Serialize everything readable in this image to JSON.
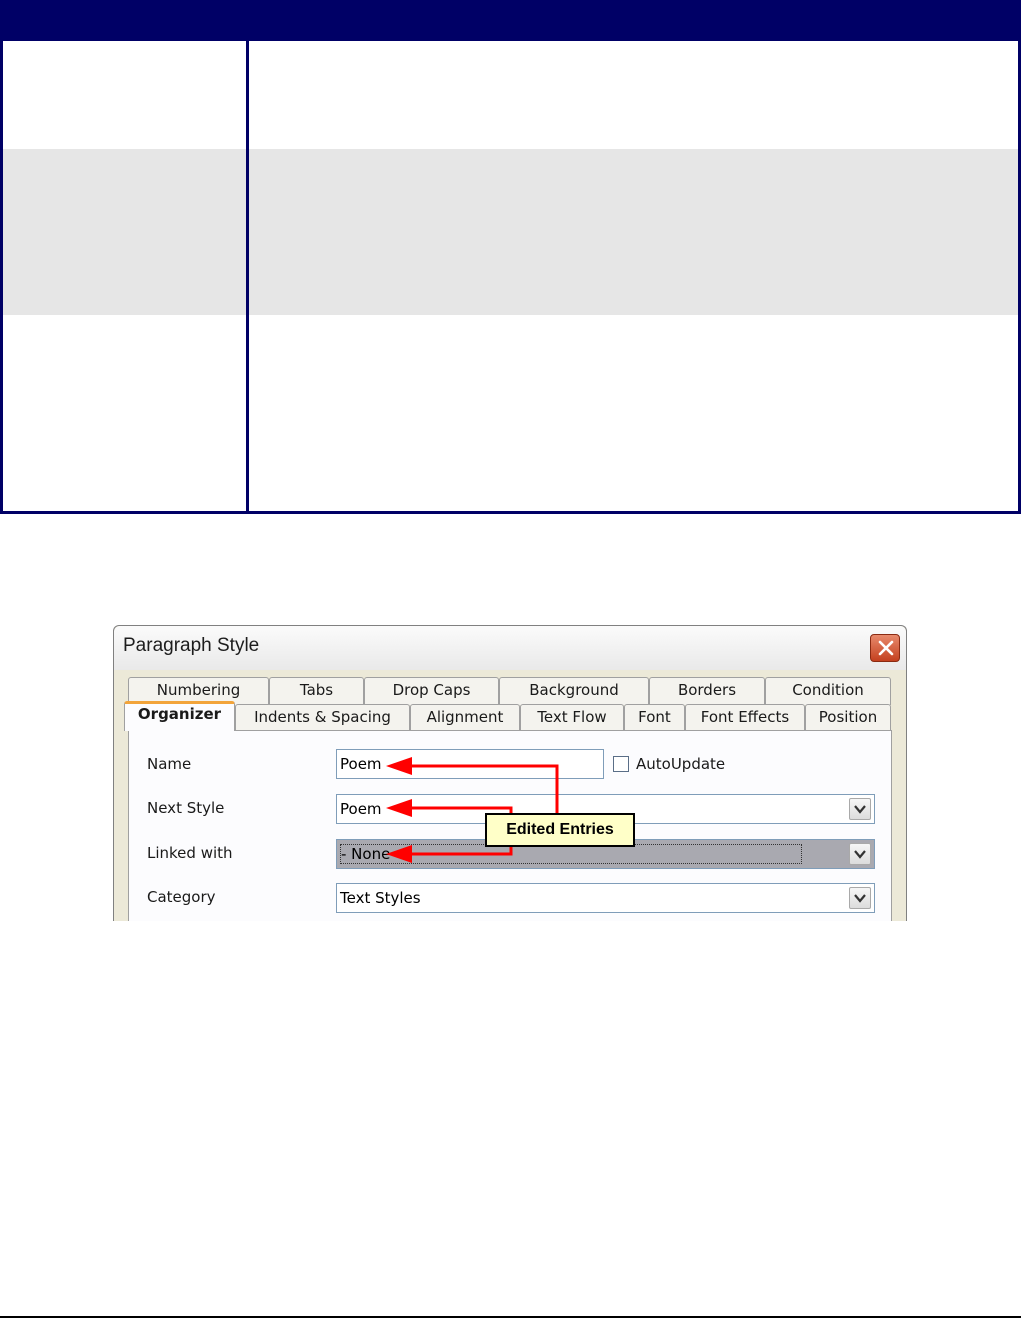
{
  "dialog": {
    "title": "Paragraph Style",
    "tabs_row1": [
      "Numbering",
      "Tabs",
      "Drop Caps",
      "Background",
      "Borders",
      "Condition"
    ],
    "tabs_row2": [
      "Organizer",
      "Indents & Spacing",
      "Alignment",
      "Text Flow",
      "Font",
      "Font Effects",
      "Position"
    ],
    "active_tab": "Organizer",
    "fields": {
      "name": {
        "label": "Name",
        "value": "Poem"
      },
      "autoupdate": {
        "label": "AutoUpdate",
        "checked": false
      },
      "next_style": {
        "label": "Next Style",
        "value": "Poem"
      },
      "linked_with": {
        "label": "Linked with",
        "value": "- None -"
      },
      "category": {
        "label": "Category",
        "value": "Text Styles"
      }
    },
    "callout": "Edited Entries",
    "colors": {
      "arrow": "#ff0000",
      "callout_bg": "#ffffc8",
      "table_border": "#000066",
      "close_button": "#c4401f"
    }
  }
}
